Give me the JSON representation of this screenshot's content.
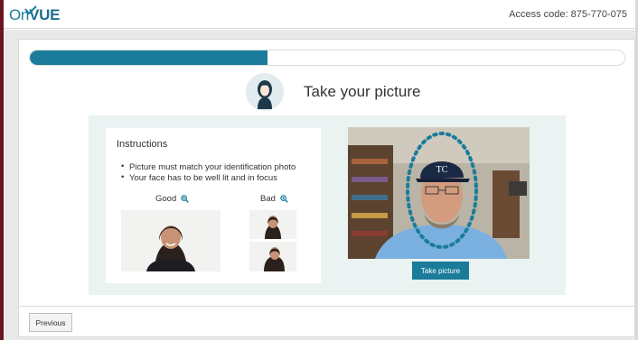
{
  "header": {
    "logo_on": "On",
    "logo_vue": "VUE",
    "access_code": "Access code: 875-770-075"
  },
  "progress": {
    "fraction": 0.4
  },
  "main": {
    "title": "Take your picture",
    "instructions": {
      "title": "Instructions",
      "bullets": [
        "Picture must match your identification photo",
        "Your face has to be well lit and in focus"
      ],
      "good_label": "Good",
      "bad_label": "Bad"
    },
    "take_picture_label": "Take picture"
  },
  "footer": {
    "previous_label": "Previous"
  },
  "colors": {
    "accent": "#1a7c9a",
    "brand": "#1b7d9b",
    "panel": "#eaf3f1"
  }
}
